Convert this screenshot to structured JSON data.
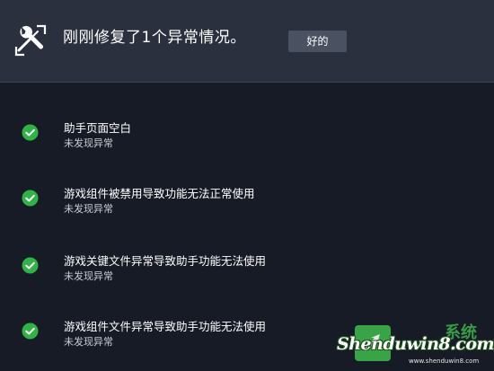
{
  "header": {
    "title": "刚刚修复了1个异常情况。",
    "ok_label": "好的",
    "icon": "wrench-repair-icon"
  },
  "checks": [
    {
      "title": "助手页面空白",
      "status": "未发现异常",
      "icon": "check-circle-icon"
    },
    {
      "title": "游戏组件被禁用导致功能无法正常使用",
      "status": "未发现异常",
      "icon": "check-circle-icon"
    },
    {
      "title": "游戏关键文件异常导致助手功能无法使用",
      "status": "未发现异常",
      "icon": "check-circle-icon"
    },
    {
      "title": "游戏组件文件异常导致助手功能无法使用",
      "status": "未发现异常",
      "icon": "check-circle-icon"
    }
  ],
  "watermark": {
    "text": "Shenduwin8.com",
    "cn_text": "系统",
    "url": "www.shenduwin8.com"
  },
  "colors": {
    "background": "#161b26",
    "header_background": "#2a303d",
    "button_background": "#4a5160",
    "check_green": "#2fb344",
    "status_text": "#c8ccd3"
  }
}
